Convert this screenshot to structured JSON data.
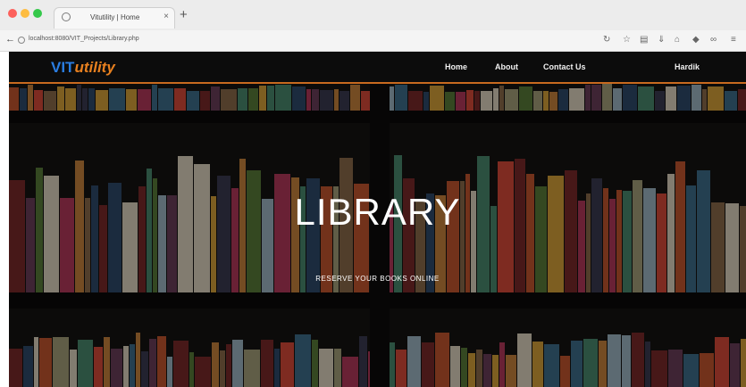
{
  "browser": {
    "tab_title": "Vitutility | Home",
    "tab_close": "×",
    "new_tab": "+",
    "back": "←",
    "url": "localhost:8080/VIT_Projects/Library.php",
    "toolbar_icons": [
      "reload-icon",
      "star-icon",
      "reader-icon",
      "download-icon",
      "home-icon",
      "shield-icon",
      "extension-icon",
      "menu-icon"
    ]
  },
  "nav": {
    "brand_vit": "VIT",
    "brand_utility": "utility",
    "links": [
      "Home",
      "About",
      "Contact Us"
    ],
    "user": "Hardik"
  },
  "hero": {
    "title": "LIBRARY",
    "subtitle": "RESERVE YOUR BOOKS ONLINE"
  },
  "colors": {
    "brand_blue": "#2a7de1",
    "brand_orange": "#e8801f",
    "nav_bg": "#0c0c0c"
  }
}
